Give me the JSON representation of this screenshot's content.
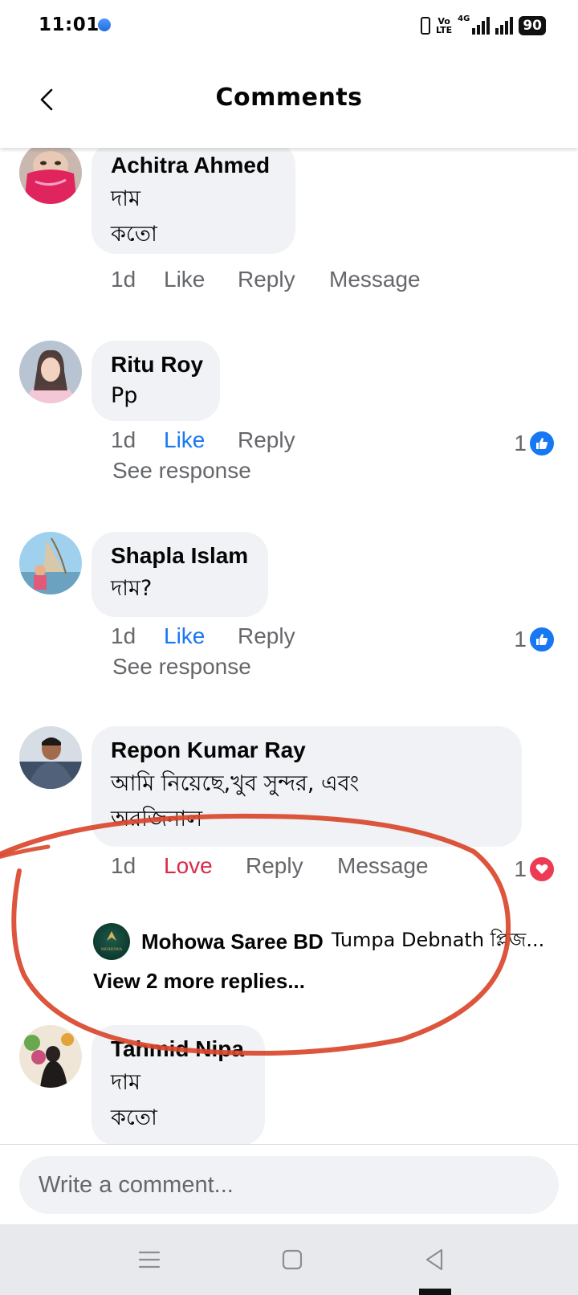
{
  "status_bar": {
    "time": "11:01",
    "volte": "Vo",
    "lte": "LTE",
    "network": "4G",
    "battery": "90"
  },
  "header": {
    "title": "Comments",
    "back_icon": "chevron-left-icon"
  },
  "comments": [
    {
      "author": "Achitra Ahmed",
      "text": "দাম\nকতো",
      "time": "1d",
      "like": "Like",
      "reply": "Reply",
      "message": "Message",
      "liked": false
    },
    {
      "author": "Ritu Roy",
      "text": "Pp",
      "time": "1d",
      "like": "Like",
      "reply": "Reply",
      "liked": true,
      "reaction_count": "1",
      "reaction": "like",
      "see_response": "See response"
    },
    {
      "author": "Shapla Islam",
      "text": "দাম?",
      "time": "1d",
      "like": "Like",
      "reply": "Reply",
      "liked": true,
      "reaction_count": "1",
      "reaction": "like",
      "see_response": "See response"
    },
    {
      "author": "Repon Kumar Ray",
      "text": "আমি নিয়েছে,খুব সুন্দর, এবং\nঅরজিনাল",
      "time": "1d",
      "like": "Love",
      "reply": "Reply",
      "message": "Message",
      "reaction_count": "1",
      "reaction": "love",
      "reply_preview": {
        "author": "Mohowa Saree BD",
        "text": "Tumpa Debnath প্লিজ...",
        "logo_text": "MOHOWA"
      },
      "view_more": "View 2 more replies..."
    },
    {
      "author": "Tahmid Nipa",
      "text": "দাম\nকতো"
    }
  ],
  "composer": {
    "placeholder": "Write a comment..."
  },
  "colors": {
    "accent": "#1877f2",
    "love": "#d92b47",
    "bubble": "#f0f2f5",
    "highlight": "#d9472b"
  }
}
